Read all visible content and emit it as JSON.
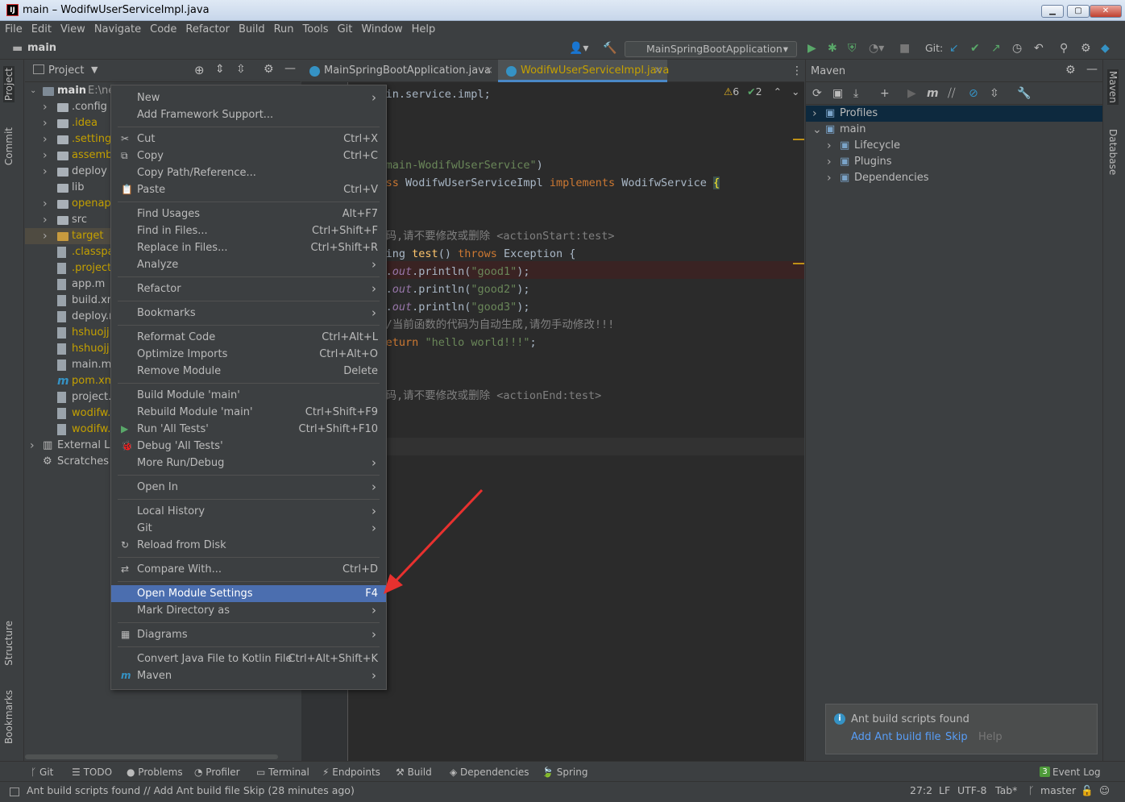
{
  "window": {
    "title": "main – WodifwUserServiceImpl.java",
    "app_icon": "IJ"
  },
  "menubar": [
    "File",
    "Edit",
    "View",
    "Navigate",
    "Code",
    "Refactor",
    "Build",
    "Run",
    "Tools",
    "Git",
    "Window",
    "Help"
  ],
  "navbar": {
    "project": "main",
    "run_config": "MainSpringBootApplication",
    "git_label": "Git:"
  },
  "left_stripe": {
    "project": "Project",
    "commit": "Commit",
    "structure": "Structure",
    "bookmarks": "Bookmarks"
  },
  "right_stripe": {
    "maven": "Maven",
    "database": "Database"
  },
  "project_panel": {
    "title": "Project",
    "root": {
      "name": "main",
      "path": "E:\\ne"
    },
    "items": [
      {
        "label": ".config",
        "kind": "folder",
        "color": "#bbbbbb",
        "arrow": true
      },
      {
        "label": ".idea",
        "kind": "folder",
        "color": "#c4a000",
        "arrow": true
      },
      {
        "label": ".settings",
        "kind": "folder",
        "color": "#c4a000",
        "arrow": true
      },
      {
        "label": "assembl",
        "kind": "folder",
        "color": "#c4a000",
        "arrow": true
      },
      {
        "label": "deploy",
        "kind": "folder",
        "color": "#bbbbbb",
        "arrow": true
      },
      {
        "label": "lib",
        "kind": "folder",
        "color": "#bbbbbb",
        "arrow": false
      },
      {
        "label": "openapi",
        "kind": "folder",
        "color": "#c4a000",
        "arrow": true
      },
      {
        "label": "src",
        "kind": "folder",
        "color": "#bbbbbb",
        "arrow": true
      },
      {
        "label": "target",
        "kind": "folder-orange",
        "color": "#c4a000",
        "arrow": true
      },
      {
        "label": ".classpat",
        "kind": "file",
        "color": "#c4a000",
        "arrow": false
      },
      {
        "label": ".project",
        "kind": "file",
        "color": "#c4a000",
        "arrow": false
      },
      {
        "label": "app.m",
        "kind": "file",
        "color": "#bbbbbb",
        "arrow": false
      },
      {
        "label": "build.xm",
        "kind": "file",
        "color": "#bbbbbb",
        "arrow": false
      },
      {
        "label": "deploy.r",
        "kind": "file",
        "color": "#bbbbbb",
        "arrow": false
      },
      {
        "label": "hshuojj1",
        "kind": "file",
        "color": "#c4a000",
        "arrow": false
      },
      {
        "label": "hshuojj1",
        "kind": "file",
        "color": "#c4a000",
        "arrow": false
      },
      {
        "label": "main.me",
        "kind": "file",
        "color": "#bbbbbb",
        "arrow": false
      },
      {
        "label": "pom.xm",
        "kind": "file-maven",
        "color": "#c4a000",
        "arrow": false
      },
      {
        "label": "project.x",
        "kind": "file",
        "color": "#bbbbbb",
        "arrow": false
      },
      {
        "label": "wodifw.s",
        "kind": "file",
        "color": "#c4a000",
        "arrow": false
      },
      {
        "label": "wodifw.s",
        "kind": "file",
        "color": "#c4a000",
        "arrow": false
      }
    ],
    "external_libs": "External Lib",
    "scratches": "Scratches a"
  },
  "editor": {
    "tabs": [
      {
        "label": "MainSpringBootApplication.java",
        "active": false
      },
      {
        "label": "WodifwUserServiceImpl.java",
        "active": true
      }
    ],
    "warnings": "6",
    "weak_warnings": "2"
  },
  "context_menu": {
    "items": [
      {
        "label": "New",
        "shortcut": "",
        "sub": true
      },
      {
        "label": "Add Framework Support...",
        "shortcut": "",
        "sub": false
      },
      {
        "sep": true
      },
      {
        "label": "Cut",
        "shortcut": "Ctrl+X",
        "icon": "✂"
      },
      {
        "label": "Copy",
        "shortcut": "Ctrl+C",
        "icon": "⧉"
      },
      {
        "label": "Copy Path/Reference...",
        "shortcut": ""
      },
      {
        "label": "Paste",
        "shortcut": "Ctrl+V",
        "icon": "📋"
      },
      {
        "sep": true
      },
      {
        "label": "Find Usages",
        "shortcut": "Alt+F7"
      },
      {
        "label": "Find in Files...",
        "shortcut": "Ctrl+Shift+F"
      },
      {
        "label": "Replace in Files...",
        "shortcut": "Ctrl+Shift+R"
      },
      {
        "label": "Analyze",
        "shortcut": "",
        "sub": true
      },
      {
        "sep": true
      },
      {
        "label": "Refactor",
        "shortcut": "",
        "sub": true
      },
      {
        "sep": true
      },
      {
        "label": "Bookmarks",
        "shortcut": "",
        "sub": true
      },
      {
        "sep": true
      },
      {
        "label": "Reformat Code",
        "shortcut": "Ctrl+Alt+L"
      },
      {
        "label": "Optimize Imports",
        "shortcut": "Ctrl+Alt+O"
      },
      {
        "label": "Remove Module",
        "shortcut": "Delete"
      },
      {
        "sep": true
      },
      {
        "label": "Build Module 'main'",
        "shortcut": ""
      },
      {
        "label": "Rebuild Module 'main'",
        "shortcut": "Ctrl+Shift+F9"
      },
      {
        "label": "Run 'All Tests'",
        "shortcut": "Ctrl+Shift+F10",
        "icon": "▶"
      },
      {
        "label": "Debug 'All Tests'",
        "shortcut": "",
        "icon": "🐞"
      },
      {
        "label": "More Run/Debug",
        "shortcut": "",
        "sub": true
      },
      {
        "sep": true
      },
      {
        "label": "Open In",
        "shortcut": "",
        "sub": true
      },
      {
        "sep": true
      },
      {
        "label": "Local History",
        "shortcut": "",
        "sub": true
      },
      {
        "label": "Git",
        "shortcut": "",
        "sub": true
      },
      {
        "label": "Reload from Disk",
        "shortcut": "",
        "icon": "↻"
      },
      {
        "sep": true
      },
      {
        "label": "Compare With...",
        "shortcut": "Ctrl+D",
        "icon": "⇄"
      },
      {
        "sep": true
      },
      {
        "label": "Open Module Settings",
        "shortcut": "F4",
        "selected": true
      },
      {
        "label": "Mark Directory as",
        "shortcut": "",
        "sub": true
      },
      {
        "sep": true
      },
      {
        "label": "Diagrams",
        "shortcut": "",
        "sub": true,
        "icon": "▦"
      },
      {
        "sep": true
      },
      {
        "label": "Convert Java File to Kotlin File",
        "shortcut": "Ctrl+Alt+Shift+K"
      },
      {
        "label": "Maven",
        "shortcut": "",
        "sub": true,
        "icon": "m"
      }
    ]
  },
  "maven_panel": {
    "title": "Maven",
    "tree": [
      {
        "label": "Profiles",
        "level": 0,
        "arrow": "›",
        "selected": true
      },
      {
        "label": "main",
        "level": 0,
        "arrow": "⌄"
      },
      {
        "label": "Lifecycle",
        "level": 1,
        "arrow": "›"
      },
      {
        "label": "Plugins",
        "level": 1,
        "arrow": "›"
      },
      {
        "label": "Dependencies",
        "level": 1,
        "arrow": "›"
      }
    ]
  },
  "notification": {
    "title": "Ant build scripts found",
    "link_add": "Add Ant build file",
    "link_skip": "Skip",
    "link_help": "Help"
  },
  "bottom_tools": [
    "Git",
    "TODO",
    "Problems",
    "Profiler",
    "Terminal",
    "Endpoints",
    "Build",
    "Dependencies",
    "Spring"
  ],
  "event_log": {
    "count": "3",
    "label": "Event Log"
  },
  "status": {
    "message": "Ant build scripts found // Add Ant build file   Skip (28 minutes ago)",
    "position": "27:2",
    "line_sep": "LF",
    "encoding": "UTF-8",
    "indent": "Tab*",
    "branch": "master"
  },
  "colors": {
    "selection": "#4b6eaf",
    "annotation_arrow": "#e8312f",
    "bg": "#2b2b2b"
  }
}
